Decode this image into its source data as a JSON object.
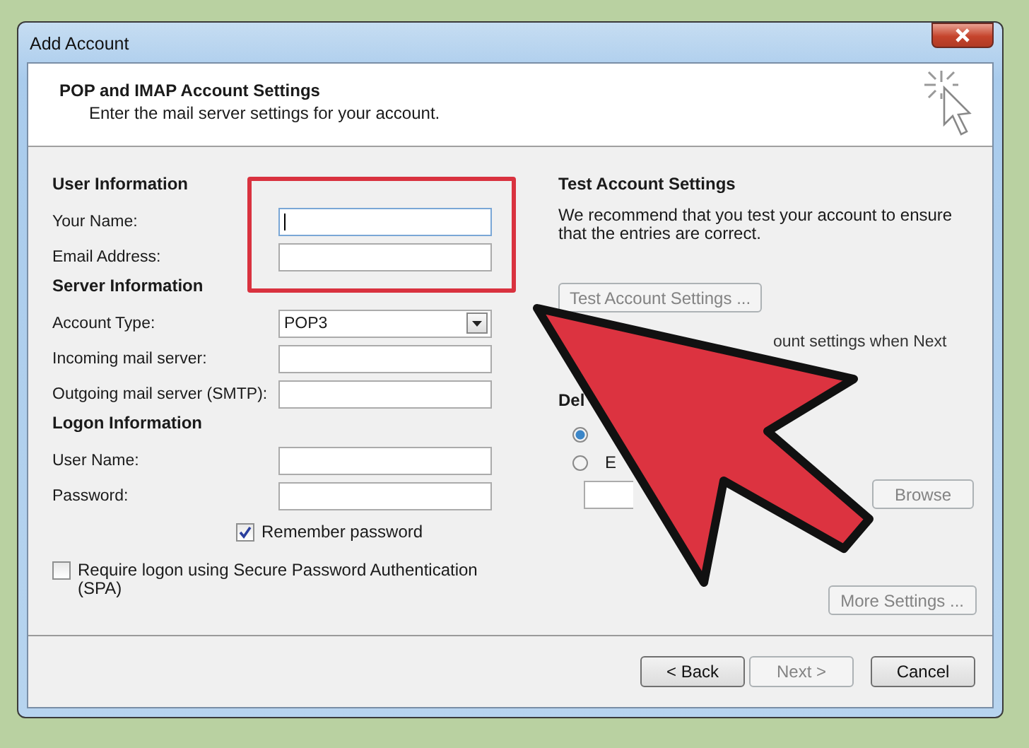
{
  "window": {
    "title": "Add Account"
  },
  "header": {
    "title": "POP and IMAP Account Settings",
    "subtitle": "Enter the mail server settings for your account."
  },
  "left_sections": [
    {
      "heading": "User Information",
      "rows": [
        {
          "kind": "text",
          "label": "Your Name:",
          "focused": true
        },
        {
          "kind": "text",
          "label": "Email Address:",
          "focused": false
        }
      ]
    },
    {
      "heading": "Server Information",
      "rows": [
        {
          "kind": "select",
          "label": "Account Type:",
          "value": "POP3"
        },
        {
          "kind": "text",
          "label": "Incoming mail server:",
          "focused": false
        },
        {
          "kind": "text",
          "label": "Outgoing mail server (SMTP):",
          "focused": false
        }
      ]
    },
    {
      "heading": "Logon Information",
      "rows": [
        {
          "kind": "text",
          "label": "User Name:",
          "focused": false
        },
        {
          "kind": "text",
          "label": "Password:",
          "focused": false
        },
        {
          "kind": "checkbox",
          "label": "Remember password",
          "checked": true,
          "indent": true
        }
      ]
    }
  ],
  "spa_option": {
    "label": "Require logon using Secure Password Authentication (SPA)",
    "checked": false
  },
  "test_panel": {
    "heading": "Test Account Settings",
    "text": "We recommend that you test your account to ensure that the entries are correct.",
    "test_button": {
      "label": "Test Account Settings ...",
      "disabled": true
    },
    "fragment": "ount settings when Next",
    "deliver_fragment": "Del",
    "radios": [
      {
        "selected": true
      },
      {
        "label": "E",
        "selected": false
      }
    ],
    "browse_button": {
      "label": "Browse",
      "disabled": true
    },
    "more_button": {
      "label": "More Settings ...",
      "disabled": true
    }
  },
  "footer_buttons": [
    {
      "label": "< Back",
      "disabled": false
    },
    {
      "label": "Next >",
      "disabled": true
    },
    {
      "label": "Cancel",
      "disabled": false
    }
  ],
  "annotations": {
    "highlight_frame": true,
    "arrow": true
  }
}
